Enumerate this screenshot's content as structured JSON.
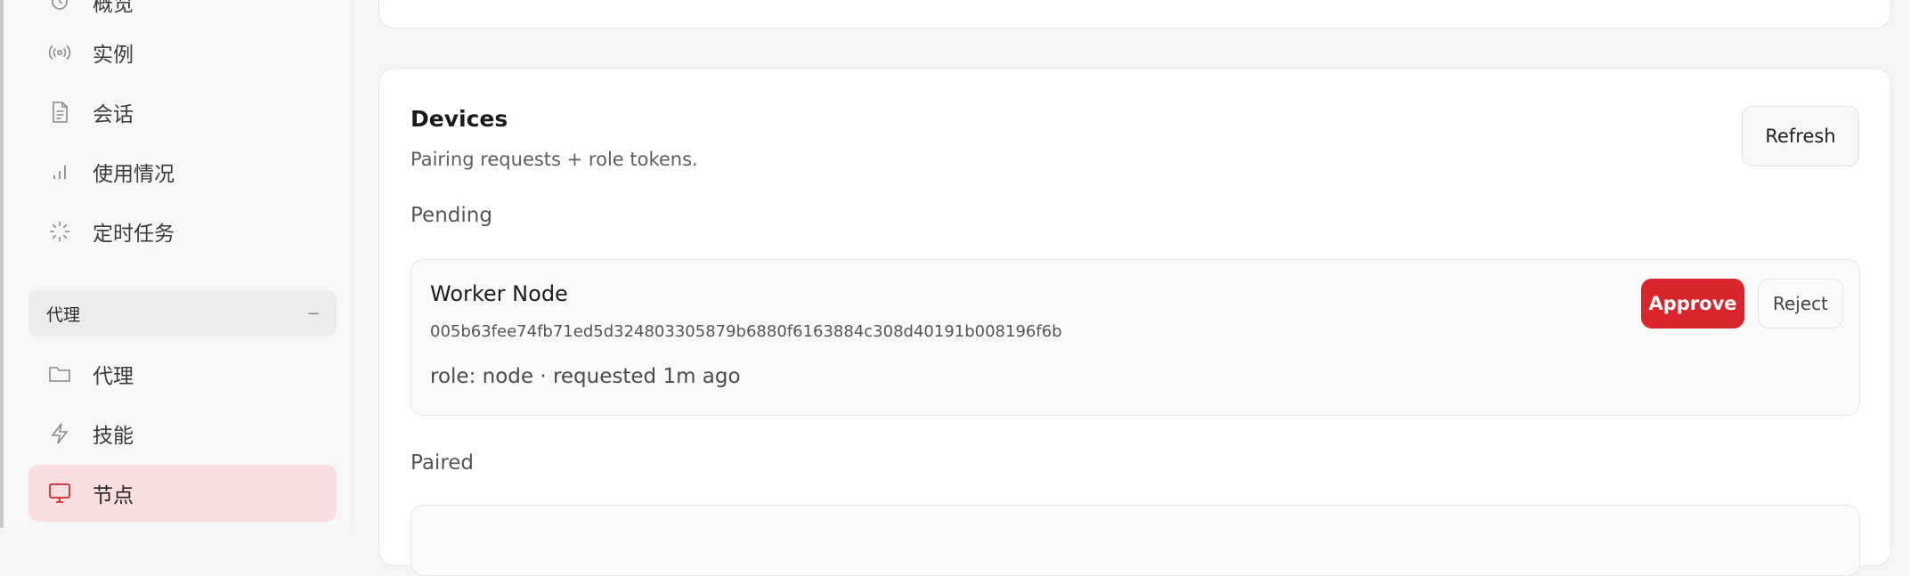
{
  "sidebar": {
    "items": [
      {
        "label": "概览",
        "icon": "activity-icon"
      },
      {
        "label": "实例",
        "icon": "radio-icon"
      },
      {
        "label": "会话",
        "icon": "document-icon"
      },
      {
        "label": "使用情况",
        "icon": "bar-chart-icon"
      },
      {
        "label": "定时任务",
        "icon": "loader-icon"
      }
    ],
    "group": {
      "title": "代理",
      "collapse": "−"
    },
    "group_items": [
      {
        "label": "代理",
        "icon": "folder-icon"
      },
      {
        "label": "技能",
        "icon": "lightning-icon"
      },
      {
        "label": "节点",
        "icon": "monitor-icon",
        "active": true
      }
    ]
  },
  "devices": {
    "title": "Devices",
    "subtitle": "Pairing requests + role tokens.",
    "refresh_label": "Refresh",
    "pending_label": "Pending",
    "paired_label": "Paired",
    "pending": [
      {
        "name": "Worker Node",
        "id": "005b63fee74fb71ed5d324803305879b6880f6163884c308d40191b008196f6b",
        "meta": "role: node · requested 1m ago",
        "approve_label": "Approve",
        "reject_label": "Reject"
      }
    ]
  },
  "colors": {
    "accent": "#d8262c",
    "active_bg": "#f8dede"
  }
}
